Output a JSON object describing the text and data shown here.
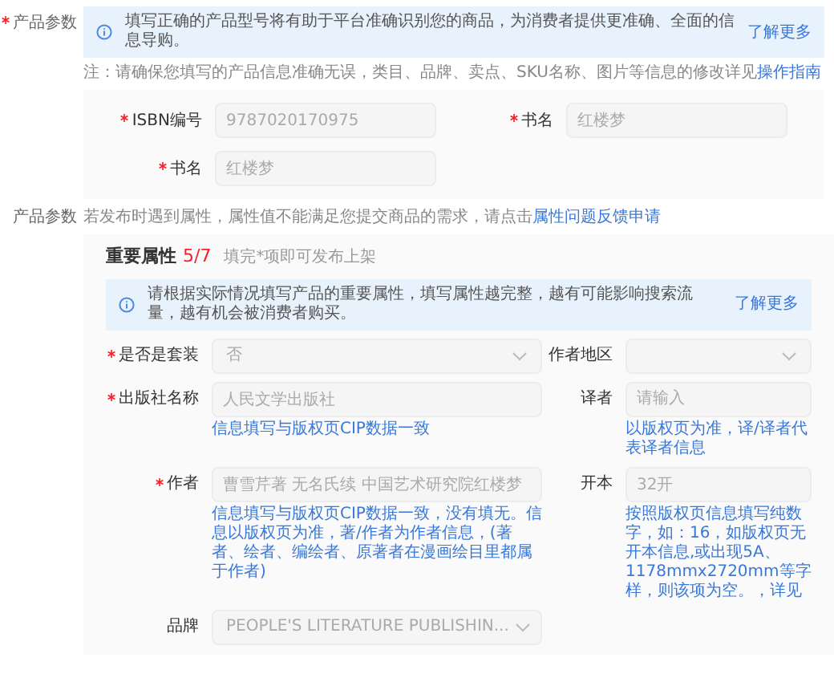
{
  "section1": {
    "label": "产品参数",
    "required": true,
    "notice": {
      "text": "填写正确的产品型号将有助于平台准确识别您的商品，为消费者提供更准确、全面的信息导购。",
      "link": "了解更多"
    },
    "note": {
      "text": "注：请确保您填写的产品信息准确无误，类目、品牌、卖点、SKU名称、图片等信息的修改详见",
      "link": "操作指南"
    },
    "fields": [
      {
        "label": "ISBN编号",
        "required": true,
        "kind": "input",
        "value": "9787020170975"
      },
      {
        "label": "书名",
        "required": true,
        "kind": "input",
        "value": "红楼梦"
      },
      {
        "label": "书名",
        "required": true,
        "kind": "input",
        "value": "红楼梦"
      }
    ]
  },
  "section2": {
    "label": "产品参数",
    "required": false,
    "note": {
      "text": "若发布时遇到属性，属性值不能满足您提交商品的需求，请点击",
      "link": "属性问题反馈申请"
    },
    "title": "重要属性",
    "count": "5/7",
    "subtitle": "填完*项即可发布上架",
    "notice": {
      "text": "请根据实际情况填写产品的重要属性，填写属性越完整，越有可能影响搜索流量，越有机会被消费者购买。",
      "link": "了解更多"
    },
    "fields": [
      {
        "label": "是否是套装",
        "required": true,
        "kind": "select",
        "value": "否"
      },
      {
        "label": "作者地区",
        "required": false,
        "kind": "select"
      },
      {
        "label": "出版社名称",
        "required": true,
        "kind": "input",
        "value": "人民文学出版社",
        "hint": "信息填写与版权页CIP数据一致"
      },
      {
        "label": "译者",
        "required": false,
        "kind": "input",
        "placeholder": "请输入",
        "hint": "以版权页为准，译/译者代表译者信息"
      },
      {
        "label": "作者",
        "required": true,
        "kind": "input",
        "value": "曹雪芹著 无名氏续 中国艺术研究院红楼梦",
        "hint": "信息填写与版权页CIP数据一致，没有填无。信息以版权页为准，著/作者为作者信息，(著者、绘者、编绘者、原著者在漫画绘目里都属于作者)"
      },
      {
        "label": "开本",
        "required": false,
        "kind": "input",
        "value": "32开",
        "hint": "按照版权页信息填写纯数字，如：16，如版权页无开本信息,或出现5A、1178mmx2720mm等字样，则该项为空。，详见"
      },
      {
        "label": "品牌",
        "required": false,
        "kind": "select",
        "value": "PEOPLE'S LITERATURE PUBLISHIN..."
      }
    ]
  }
}
